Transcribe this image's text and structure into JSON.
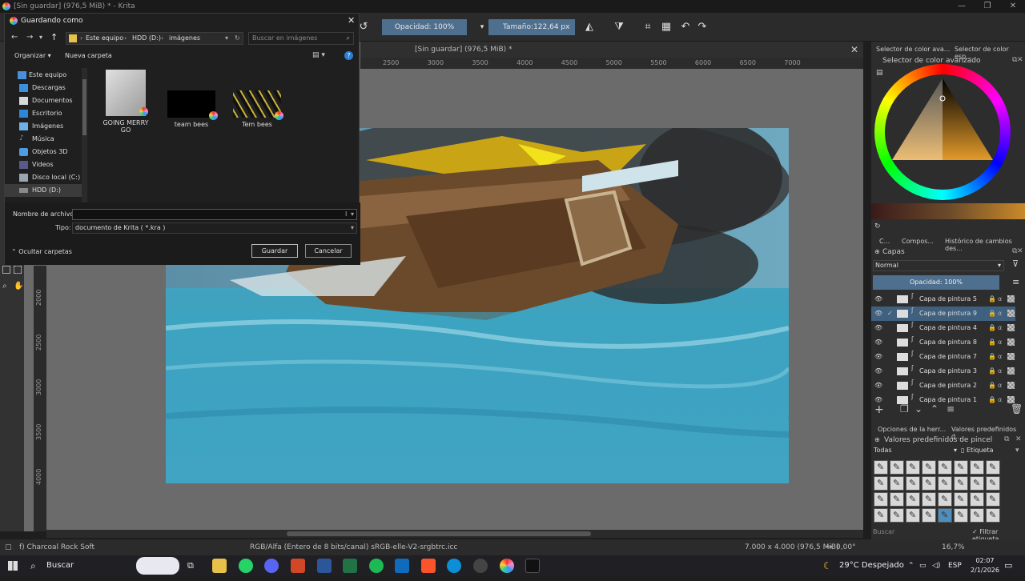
{
  "window": {
    "title": "[Sin guardar]  (976,5 MiB) * - Krita"
  },
  "toolbar": {
    "opacity_label": "Opacidad: 100%",
    "size_label": "Tamaño:",
    "size_value": "122,64 px"
  },
  "document": {
    "tab_title": "[Sin guardar]  (976,5 MiB) *"
  },
  "ruler": {
    "h_ticks": [
      "2500",
      "3000",
      "3500",
      "4000",
      "4500",
      "5000",
      "5500",
      "6000",
      "6500",
      "7000"
    ],
    "v_ticks": [
      "2000",
      "2500",
      "3000",
      "3500",
      "4000"
    ]
  },
  "dialog": {
    "title": "Guardando como",
    "breadcrumb": [
      "Este equipo",
      "HDD (D:)",
      "imágenes"
    ],
    "search_placeholder": "Buscar en imágenes",
    "organize": "Organizar",
    "new_folder": "Nueva carpeta",
    "nav_items": [
      "Este equipo",
      "Descargas",
      "Documentos",
      "Escritorio",
      "Imágenes",
      "Música",
      "Objetos 3D",
      "Videos",
      "Disco local (C:)",
      "HDD (D:)"
    ],
    "files": [
      {
        "name": "GOING MERRY GO"
      },
      {
        "name": "team bees"
      },
      {
        "name": "Tem bees"
      }
    ],
    "filename_label": "Nombre de archivo:",
    "filename_value": "",
    "type_label": "Tipo:",
    "type_value": "documento de Krita ( *.kra )",
    "save_button": "Guardar",
    "cancel_button": "Cancelar",
    "hide_folders": "Ocultar carpetas"
  },
  "dock": {
    "color_tabs": [
      "Selector de color ava...",
      "Selector de color esp..."
    ],
    "color_header": "Selector de color avanzado",
    "mid_tabs": [
      "C...",
      "Compos...",
      "Histórico de cambios des..."
    ],
    "layers_header": "Capas",
    "blend_mode": "Normal",
    "layer_opacity": "Opacidad:  100%",
    "layers": [
      {
        "name": "Capa de pintura 5"
      },
      {
        "name": "Capa de pintura 9"
      },
      {
        "name": "Capa de pintura 4"
      },
      {
        "name": "Capa de pintura 8"
      },
      {
        "name": "Capa de pintura 7"
      },
      {
        "name": "Capa de pintura 3"
      },
      {
        "name": "Capa de pintura 2"
      },
      {
        "name": "Capa de pintura 1"
      }
    ],
    "bottom_tabs": [
      "Opciones de la herr...",
      "Valores predefinidos d..."
    ],
    "brush_header": "Valores predefinidos de pincel",
    "brush_filter": "Todas",
    "brush_tag": "Etiqueta",
    "brush_search": "Buscar",
    "filter_tag": "Filtrar etiqueta"
  },
  "status": {
    "brush": "f) Charcoal Rock Soft",
    "color_info": "RGB/Alfa (Entero de 8 bits/canal)  sRGB-elle-V2-srgbtrc.icc",
    "dimensions": "7.000 x 4.000 (976,5 MiB)",
    "rotation": "0,00°",
    "zoom": "16,7%"
  },
  "taskbar": {
    "search": "Buscar",
    "weather": "29°C  Despejado",
    "lang": "ESP",
    "time": "02:07",
    "date": "2/1/2026"
  }
}
